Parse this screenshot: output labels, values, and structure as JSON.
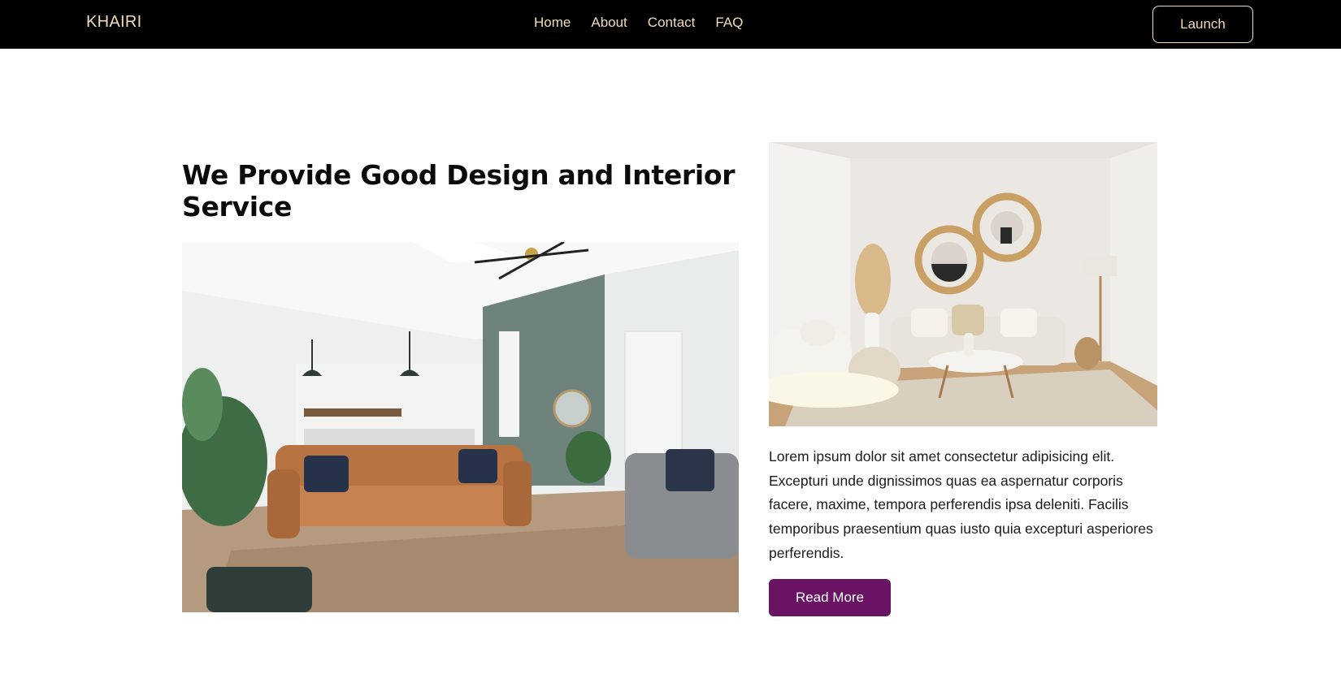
{
  "header": {
    "brand": "KHAIRI",
    "nav": [
      "Home",
      "About",
      "Contact",
      "FAQ"
    ],
    "launch_label": "Launch"
  },
  "hero": {
    "title": "We Provide Good Design and Interior Service",
    "description": "Lorem ipsum dolor sit amet consectetur adipisicing elit. Excepturi unde dignissimos quas ea aspernatur corporis facere, maxime, tempora perferendis ipsa deleniti. Facilis temporibus praesentium quas iusto quia excepturi asperiores perferendis.",
    "read_more_label": "Read More"
  },
  "colors": {
    "header_bg": "#000000",
    "header_text": "#f1dcb8",
    "button_bg": "#6a1263"
  }
}
